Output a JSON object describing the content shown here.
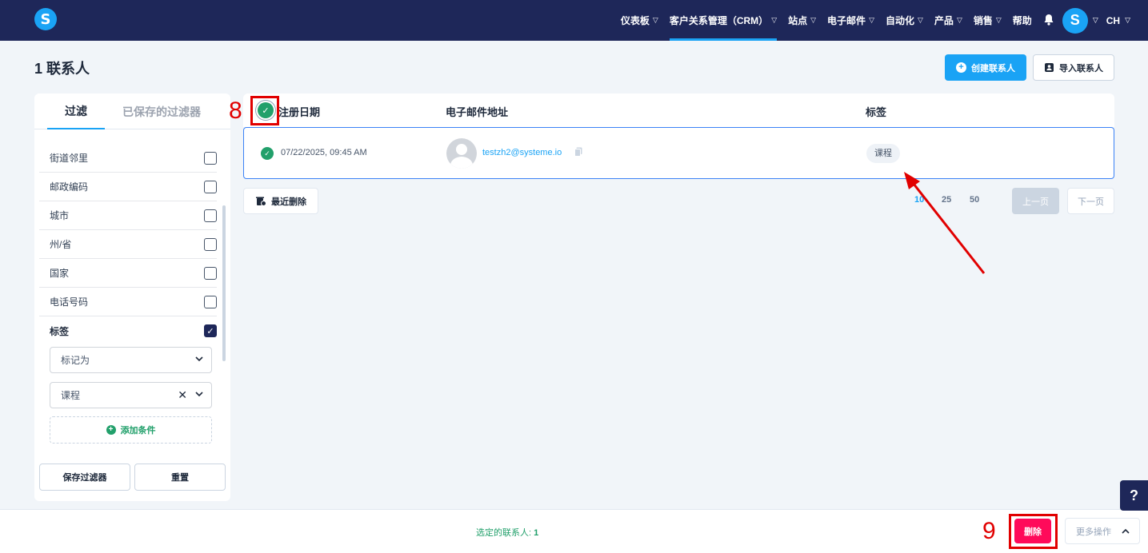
{
  "nav": {
    "items": [
      {
        "label": "仪表板",
        "chev": true
      },
      {
        "label": "客户关系管理（CRM）",
        "chev": true,
        "active": true
      },
      {
        "label": "站点",
        "chev": true
      },
      {
        "label": "电子邮件",
        "chev": true
      },
      {
        "label": "自动化",
        "chev": true
      },
      {
        "label": "产品",
        "chev": true
      },
      {
        "label": "销售",
        "chev": true
      },
      {
        "label": "帮助",
        "chev": false
      }
    ],
    "logo_letter": "S",
    "avatar_letter": "S",
    "lang": "CH"
  },
  "page": {
    "title": "1 联系人",
    "create_contact": "创建联系人",
    "import_contact": "导入联系人"
  },
  "sidebar": {
    "tab_filter": "过滤",
    "tab_saved": "已保存的过滤器",
    "filters": [
      {
        "label": "街道邻里",
        "checked": false
      },
      {
        "label": "邮政编码",
        "checked": false
      },
      {
        "label": "城市",
        "checked": false
      },
      {
        "label": "州/省",
        "checked": false
      },
      {
        "label": "国家",
        "checked": false
      },
      {
        "label": "电话号码",
        "checked": false
      }
    ],
    "tag_filter_label": "标签",
    "tag_condition": "标记为",
    "tag_value": "课程",
    "add_condition": "添加条件",
    "save_filter": "保存过滤器",
    "reset": "重置"
  },
  "table": {
    "col_date": "注册日期",
    "col_email": "电子邮件地址",
    "col_tags": "标签",
    "rows": [
      {
        "date": "07/22/2025, 09:45 AM",
        "email": "testzh2@systeme.io",
        "tag": "课程"
      }
    ],
    "recent_deleted": "最近删除",
    "page_sizes": [
      "10",
      "25",
      "50"
    ],
    "prev": "上一页",
    "next": "下一页"
  },
  "bottom": {
    "selected_label": "选定的联系人:",
    "selected_count": "1",
    "delete": "删除",
    "more_actions": "更多操作"
  },
  "help": "?",
  "annotations": {
    "step8": "8",
    "step9": "9"
  },
  "colors": {
    "nav_bg": "#1e2759",
    "accent": "#1aa3f5",
    "success": "#22a06b",
    "danger": "#ff0a5a",
    "annotation": "#e10000"
  }
}
